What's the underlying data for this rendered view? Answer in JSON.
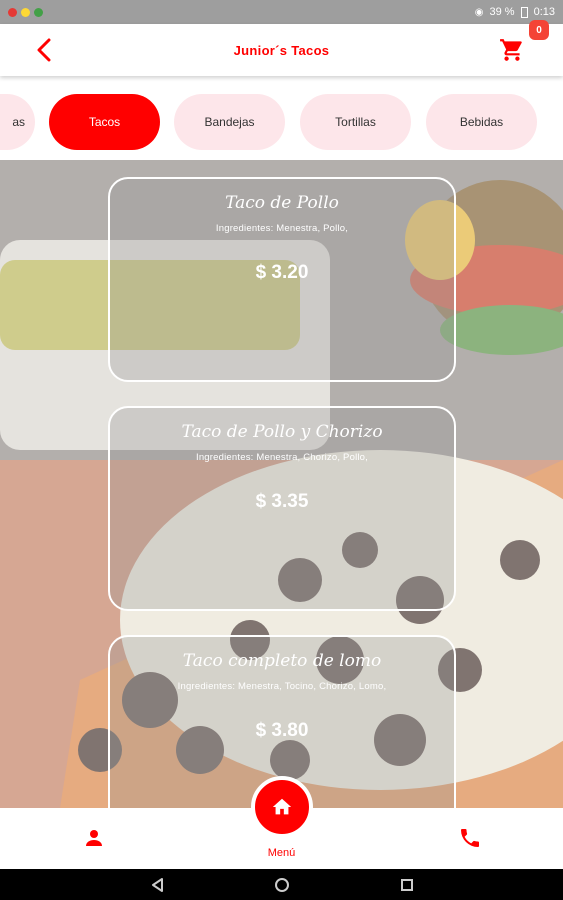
{
  "status_bar": {
    "battery": "39 %",
    "time": "0:13"
  },
  "app_bar": {
    "title": "Junior´s Tacos",
    "cart_count": "0"
  },
  "categories": [
    {
      "label": "as"
    },
    {
      "label": "Tacos",
      "selected": true
    },
    {
      "label": "Bandejas"
    },
    {
      "label": "Tortillas"
    },
    {
      "label": "Bebidas"
    }
  ],
  "products": [
    {
      "name": "Taco de Pollo",
      "ingredients": "Ingredientes: Menestra, Pollo,",
      "price": "$ 3.20"
    },
    {
      "name": "Taco de Pollo y Chorizo",
      "ingredients": "Ingredientes: Menestra, Chorizo, Pollo,",
      "price": "$ 3.35"
    },
    {
      "name": "Taco completo de lomo",
      "ingredients": "Ingredientes: Menestra, Tocino, Chorizo, Lomo,",
      "price": "$ 3.80"
    }
  ],
  "bottom_nav": {
    "center_label": "Menú"
  },
  "colors": {
    "accent": "#ff0000",
    "chip_bg": "#fde6ea"
  },
  "icons": [
    "back-arrow-icon",
    "cart-icon",
    "user-icon",
    "home-icon",
    "phone-icon",
    "system-back-icon",
    "system-home-icon",
    "system-recents-icon"
  ]
}
